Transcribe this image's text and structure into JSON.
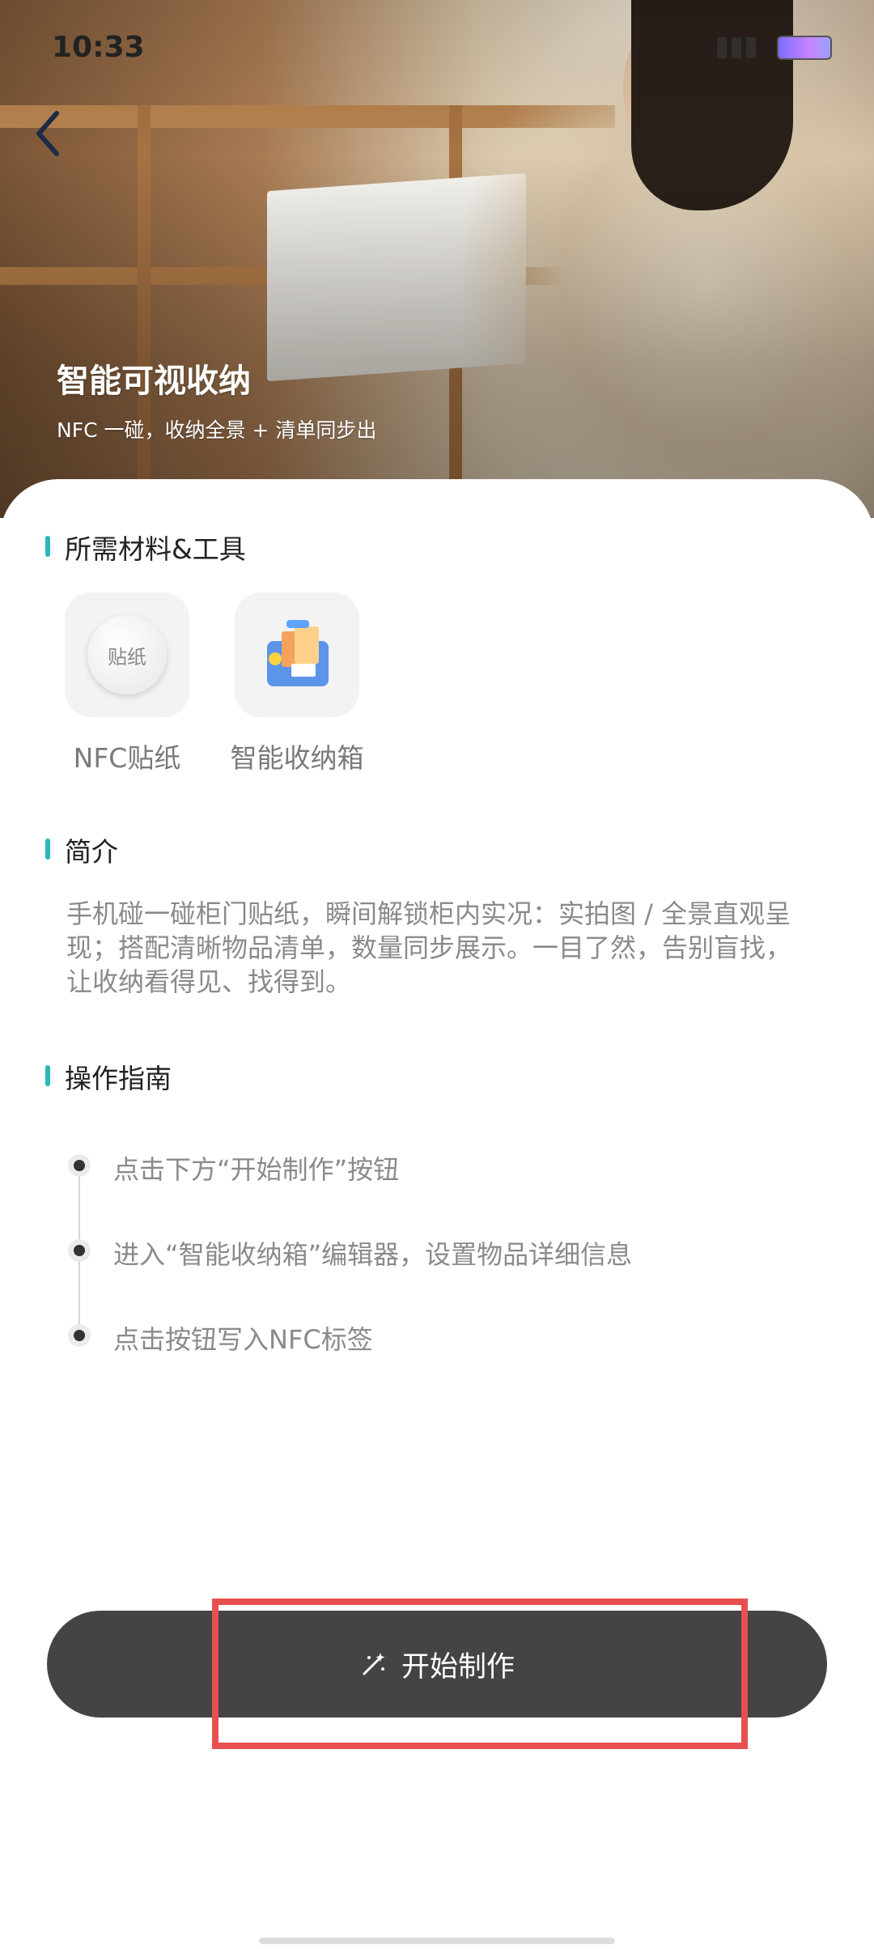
{
  "status_bar": {
    "time": "10:33"
  },
  "hero": {
    "title": "智能可视收纳",
    "subtitle": "NFC 一碰，收纳全景 + 清单同步出"
  },
  "materials": {
    "section_title": "所需材料&工具",
    "items": [
      {
        "label": "NFC贴纸",
        "icon_text": "贴纸",
        "icon": "nfc-sticker-icon"
      },
      {
        "label": "智能收纳箱",
        "icon": "storage-box-icon"
      }
    ]
  },
  "intro": {
    "section_title": "简介",
    "text": "手机碰一碰柜门贴纸，瞬间解锁柜内实况：实拍图 / 全景直观呈现；搭配清晰物品清单，数量同步展示。一目了然，告别盲找，让收纳看得见、找得到。"
  },
  "guide": {
    "section_title": "操作指南",
    "steps": [
      "点击下方“开始制作”按钮",
      "进入“智能收纳箱”编辑器，设置物品详细信息",
      "点击按钮写入NFC标签"
    ]
  },
  "action": {
    "start_label": "开始制作",
    "icon": "magic-wand-icon"
  },
  "colors": {
    "accent": "#29b7b7",
    "button_bg": "#444444",
    "highlight": "#e84f4f"
  }
}
